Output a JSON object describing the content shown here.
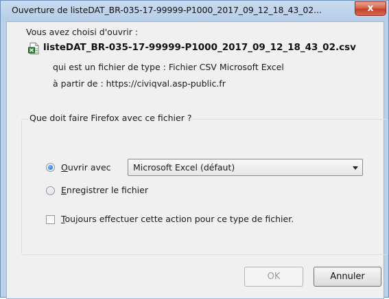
{
  "window": {
    "title": "Ouverture de listeDAT_BR-035-17-99999-P1000_2017_09_12_18_43_02...",
    "close_label": "x"
  },
  "dialog": {
    "intro": "Vous avez choisi d'ouvrir :",
    "filename": "listeDAT_BR-035-17-99999-P1000_2017_09_12_18_43_02.csv",
    "type_line": "qui est un fichier de type : Fichier CSV Microsoft Excel",
    "source_line": "à partir de : https://civiqval.asp-public.fr",
    "file_icon": "excel-csv-file-icon"
  },
  "action_group": {
    "legend": "Que doit faire Firefox avec ce fichier ?",
    "open_with": {
      "accesskey": "O",
      "label_rest": "uvrir avec",
      "checked": true
    },
    "open_with_app": "Microsoft Excel (défaut)",
    "save_file": {
      "accesskey": "E",
      "label_rest": "nregistrer le fichier",
      "checked": false
    },
    "always_do": {
      "accesskey": "T",
      "label_rest": "oujours effectuer cette action pour ce type de fichier.",
      "checked": false
    }
  },
  "buttons": {
    "ok_label": "OK",
    "cancel_label": "Annuler"
  }
}
